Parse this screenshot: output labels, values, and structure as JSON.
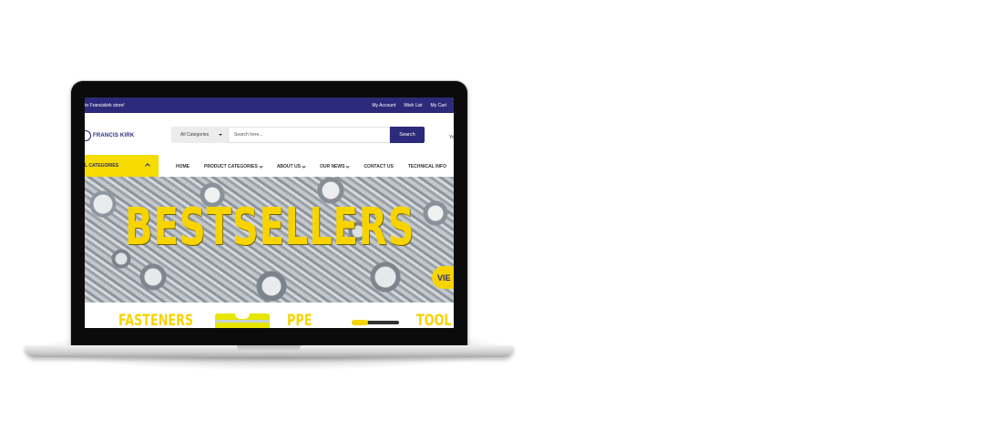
{
  "site": {
    "topbar": {
      "welcome": "to Franciskirk store!",
      "links": [
        "My Account",
        "Wish List",
        "My Cart"
      ]
    },
    "logo_text": "FRANCIS KIRK",
    "search": {
      "category_label": "All Categories",
      "placeholder": "Search here...",
      "button_label": "Search"
    },
    "header_right_text": "Yo",
    "categories_button": "L CATEGORIES",
    "menu": [
      {
        "label": "HOME",
        "has_dropdown": false
      },
      {
        "label": "PRODUCT CATEGORIES",
        "has_dropdown": true
      },
      {
        "label": "ABOUT US",
        "has_dropdown": true
      },
      {
        "label": "OUR NEWS",
        "has_dropdown": true
      },
      {
        "label": "CONTACT US",
        "has_dropdown": false
      },
      {
        "label": "TECHNICAL INFO",
        "has_dropdown": false
      }
    ],
    "banner": {
      "title": "BESTSELLERS",
      "button_label": "VIE"
    },
    "tiles": [
      "FASTENERS",
      "PPE",
      "TOOL"
    ]
  },
  "colors": {
    "brand_navy": "#2c2a7a",
    "brand_yellow": "#f7d400"
  }
}
